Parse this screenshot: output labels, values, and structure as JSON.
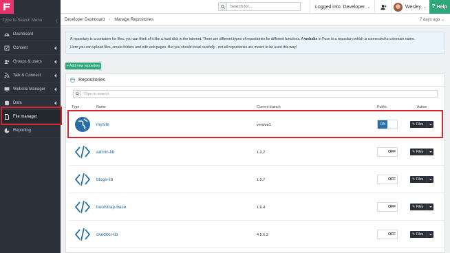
{
  "sidebar": {
    "search_placeholder": "Type to Search Menu",
    "items": [
      {
        "label": "Dashboard",
        "icon": "dashboard-icon"
      },
      {
        "label": "Content",
        "icon": "content-icon"
      },
      {
        "label": "Groups & users",
        "icon": "users-icon"
      },
      {
        "label": "Talk & Connect",
        "icon": "rss-icon"
      },
      {
        "label": "Website Manager",
        "icon": "monitor-icon"
      },
      {
        "label": "Data",
        "icon": "database-icon"
      },
      {
        "label": "File manager",
        "icon": "file-icon"
      },
      {
        "label": "Reporting",
        "icon": "chart-icon"
      }
    ]
  },
  "topbar": {
    "search_placeholder": "Search for...",
    "logged_in": "Logged into: Developer",
    "username": "Wesley",
    "help_label": "Help"
  },
  "breadcrumb": {
    "items": [
      "Developer Dashboard",
      "Manage Repositories"
    ],
    "time_ago": "7 days ago"
  },
  "info": {
    "line1_a": "A repository is a container for files, you can think of it like a hard disk in the internet. There are different types of repositories for different functions. A ",
    "line1_b": "website",
    "line1_c": " in Fuse is a repository which is connected to a domain name.",
    "line2": "Here you can upload files, create folders and edit web pages. But you should tread carefully - not all repositories are meant to be used this way!"
  },
  "add_button": "+ Add new repository",
  "panel": {
    "title": "Repositories",
    "filter_placeholder": "Type to search",
    "columns": {
      "type": "Type",
      "name": "Name",
      "branch": "Current branch",
      "public": "Public",
      "action": "Action"
    }
  },
  "repositories": [
    {
      "name": "mysite",
      "branch": "version1",
      "public": "ON",
      "type_icon": "globe-icon"
    },
    {
      "name": "admin-lib",
      "branch": "1.0.2",
      "public": "OFF",
      "type_icon": "code-icon"
    },
    {
      "name": "blogs-lib",
      "branch": "1.0.7",
      "public": "OFF",
      "type_icon": "code-icon"
    },
    {
      "name": "bootstrap-base",
      "branch": "1.6.4",
      "public": "OFF",
      "type_icon": "code-icon"
    },
    {
      "name": "ckeditor-lib",
      "branch": "4.5.6.2",
      "public": "OFF",
      "type_icon": "code-icon"
    }
  ],
  "files_label": "Files",
  "colors": {
    "sidebar_bg": "#2c3038",
    "accent_green": "#2ea87a",
    "logo_pink": "#e8336b",
    "link_blue": "#2a6a9c",
    "highlight_red": "#d9232e"
  }
}
